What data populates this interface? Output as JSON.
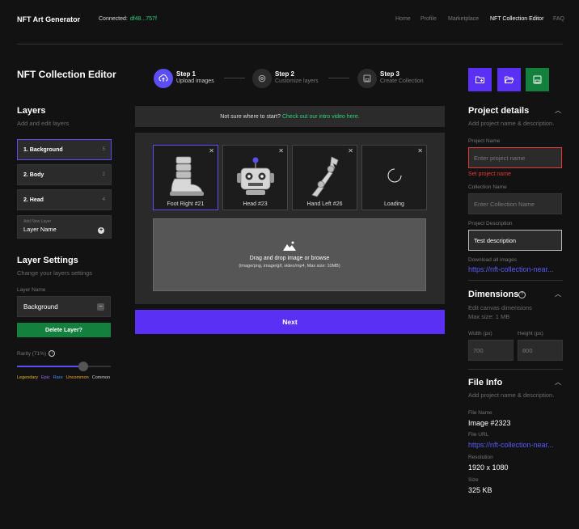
{
  "header": {
    "brand": "NFT Art Generator",
    "connected_label": "Connected:",
    "wallet": "df48...757f",
    "nav": [
      "Home",
      "Profile",
      "Marketplace",
      "NFT Collection Editor",
      "FAQ"
    ],
    "active_nav": "NFT Collection Editor"
  },
  "page_title": "NFT Collection Editor",
  "steps": [
    {
      "title": "Step 1",
      "sub": "Upload images",
      "icon": "upload-icon"
    },
    {
      "title": "Step 2",
      "sub": "Customize layers",
      "icon": "settings-icon"
    },
    {
      "title": "Step 3",
      "sub": "Create Collection",
      "icon": "save-icon"
    }
  ],
  "actions": {
    "colors": [
      "#5b30f5",
      "#5b30f5",
      "#14803e"
    ],
    "icons": [
      "add-folder-icon",
      "open-folder-icon",
      "save-icon"
    ]
  },
  "layers": {
    "title": "Layers",
    "subtitle": "Add and edit layers",
    "items": [
      {
        "label": "1. Background",
        "count": "5"
      },
      {
        "label": "2. Body",
        "count": "2"
      },
      {
        "label": "2. Head",
        "count": "4"
      }
    ],
    "new_layer_label": "Add New Layer",
    "new_layer_value": "Layer Name"
  },
  "layer_settings": {
    "title": "Layer Settings",
    "subtitle": "Change your layers settings",
    "name_label": "Layer Name",
    "name_value": "Background",
    "delete_label": "Delete Layer?",
    "rarity_label": "Rarity (71%)",
    "rarity_value": 0.71,
    "rarity_scale": [
      {
        "label": "Legendary",
        "color": "#e6b422"
      },
      {
        "label": "Epic",
        "color": "#9c6cf5"
      },
      {
        "label": "Rare",
        "color": "#4a8cf5"
      },
      {
        "label": "Uncommon",
        "color": "#f5a623"
      },
      {
        "label": "Common",
        "color": "#cccccc"
      }
    ]
  },
  "banner": {
    "text": "Not sure where to start?",
    "link": "Check out our intro video here."
  },
  "images": [
    {
      "caption": "Foot Right #21",
      "art": "boot"
    },
    {
      "caption": "Head #23",
      "art": "robot-head"
    },
    {
      "caption": "Hand Left #26",
      "art": "robot-arm"
    },
    {
      "caption": "Loading",
      "art": "spinner"
    }
  ],
  "drop": {
    "title": "Drag and drop image or browse",
    "sub": "(image/png, image/gif, video/mp4, Max size: 10MB)"
  },
  "next_label": "Next",
  "project": {
    "title": "Project details",
    "subtitle": "Add project name & description.",
    "name_label": "Project Name",
    "name_placeholder": "Enter project name",
    "name_error": "Set project name",
    "collection_label": "Collection Name",
    "collection_placeholder": "Enter Collection Name",
    "desc_label": "Project Description",
    "desc_value": "Test description",
    "download_label": "Download all images",
    "download_link": "https://nft-collection-near..."
  },
  "dimensions": {
    "title": "Dimensions",
    "subtitle": "Edit canvas dimensions",
    "max": "Max size: 1 MB",
    "width_label": "Width (px)",
    "width_placeholder": "700",
    "height_label": "Height (px)",
    "height_placeholder": "800"
  },
  "file_info": {
    "title": "File Info",
    "subtitle": "Add project name & description.",
    "name_label": "File Name",
    "name_value": "Image #2323",
    "url_label": "File URL",
    "url_value": "https://nft-collection-near...",
    "res_label": "Resolution",
    "res_value": "1920 x 1080",
    "size_label": "Size",
    "size_value": "325 KB"
  }
}
